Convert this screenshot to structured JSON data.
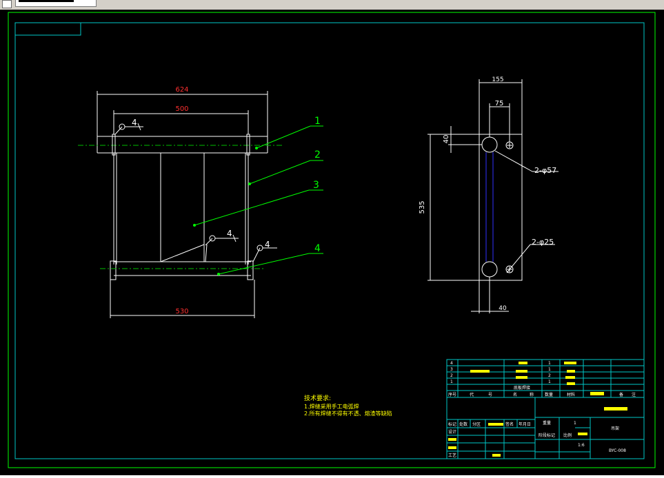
{
  "toolbar": {
    "combo_label": ""
  },
  "colors": {
    "background": "#000000",
    "border": "#00ff00",
    "frame": "#00c8c8",
    "geometry": "#ffffff",
    "dimension_text": "#ff3030",
    "leader": "#00ff00",
    "notes": "#ffff00",
    "hidden_line": "#3030ff"
  },
  "front_view": {
    "dims": {
      "overall_width": "624",
      "inner_width": "500",
      "bottom_width": "530"
    },
    "weld_symbol": "4",
    "callouts": [
      "1",
      "2",
      "3",
      "4"
    ]
  },
  "side_view": {
    "dims": {
      "width": "155",
      "hole_offset": "75",
      "top_offset": "40",
      "height": "535",
      "bottom_offset": "40"
    },
    "large_holes": "2-φ57",
    "small_holes": "2-φ25"
  },
  "tech_notes": {
    "title": "技术要求:",
    "items": [
      "1.焊缝采用手工电弧焊",
      "2.所有焊缝不得有不透、熔渣等缺陷"
    ]
  },
  "title_block": {
    "bom_rows": [
      {
        "no": "4",
        "qty": "1"
      },
      {
        "no": "3",
        "qty": "1"
      },
      {
        "no": "2",
        "qty": "2"
      },
      {
        "no": "1",
        "qty": "1",
        "name": "底板焊接"
      }
    ],
    "header": [
      "序号",
      "代",
      "号",
      "名",
      "称",
      "数量",
      "材料",
      "备",
      "注"
    ],
    "labels": {
      "mark": "标记",
      "count": "处数",
      "zone": "分区",
      "change_doc": "更改文件号",
      "sign": "签名",
      "date": "年月日",
      "design": "设计",
      "stage_mark": "阶段标记",
      "weight": "重量",
      "scale_label": "比例",
      "craft": "工艺",
      "weight_value": "1",
      "scale_value": "1:6",
      "part_name": "吊架",
      "drawing_no": "BYC-008"
    }
  }
}
